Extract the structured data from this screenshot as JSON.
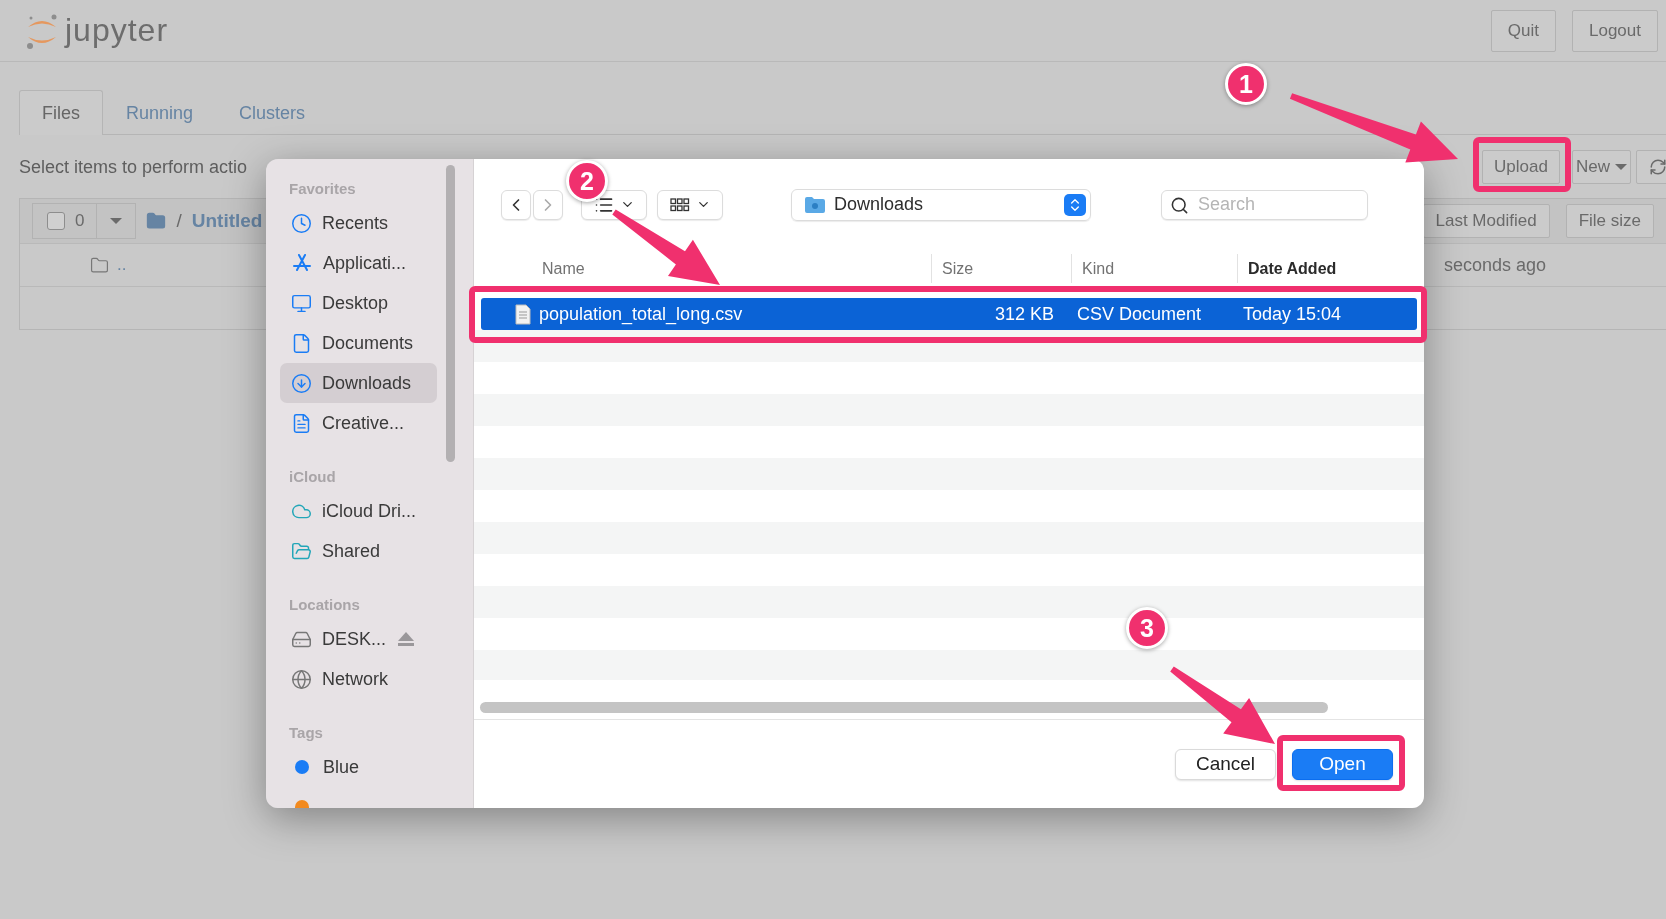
{
  "app": {
    "logo": "jupyter",
    "buttons": [
      "Quit",
      "Logout"
    ]
  },
  "tabs": [
    {
      "label": "Files",
      "selected": true
    },
    {
      "label": "Running",
      "selected": false
    },
    {
      "label": "Clusters",
      "selected": false
    }
  ],
  "toolbar": {
    "hint": "Select items to perform actio",
    "buttons": [
      {
        "kind": "text",
        "label": "Upload"
      },
      {
        "kind": "dropdown",
        "label": "New"
      },
      {
        "kind": "refresh"
      }
    ]
  },
  "file_list": {
    "checked": false,
    "count": "0",
    "root": "/",
    "path": "Untitled",
    "sort_buttons": [
      "Last Modified",
      "File size"
    ],
    "rows": [
      {
        "name": "..",
        "modified": "seconds ago"
      }
    ]
  },
  "dialog": {
    "location": "Downloads",
    "search_placeholder": "Search",
    "sidebar": [
      {
        "heading": "Favorites",
        "items": [
          {
            "kind": "place",
            "label": "Recents",
            "selected": false
          },
          {
            "kind": "place",
            "label": "Applicati...",
            "selected": false
          },
          {
            "kind": "place",
            "label": "Desktop",
            "selected": false
          },
          {
            "kind": "place",
            "label": "Documents",
            "selected": false
          },
          {
            "kind": "place",
            "label": "Downloads",
            "selected": true
          },
          {
            "kind": "place",
            "label": "Creative...",
            "selected": false
          }
        ]
      },
      {
        "heading": "iCloud",
        "items": [
          {
            "kind": "place",
            "label": "iCloud Dri...",
            "selected": false
          },
          {
            "kind": "place",
            "label": "Shared",
            "selected": false
          }
        ]
      },
      {
        "heading": "Locations",
        "items": [
          {
            "kind": "place",
            "label": "DESK...",
            "selected": false
          },
          {
            "kind": "place",
            "label": "Network",
            "selected": false
          }
        ]
      },
      {
        "heading": "Tags",
        "items": [
          {
            "kind": "tag",
            "label": "Blue",
            "color": "#1a7cf5",
            "selected": false
          },
          {
            "kind": "tag",
            "color": "#f28a1f",
            "selected": false
          }
        ]
      }
    ],
    "columns": [
      {
        "label": "Name",
        "sorted": false
      },
      {
        "label": "Size",
        "sorted": false
      },
      {
        "label": "Kind",
        "sorted": false
      },
      {
        "label": "Date Added",
        "sorted": true
      }
    ],
    "files": [
      {
        "name": "population_total_long.csv",
        "size": "312 KB",
        "kind": "CSV Document",
        "date_added": "Today 15:04",
        "selected": true
      }
    ],
    "buttons": [
      {
        "label": "Cancel",
        "primary": false
      },
      {
        "label": "Open",
        "primary": true
      }
    ]
  },
  "annotations": [
    {
      "number": "1"
    },
    {
      "number": "2"
    },
    {
      "number": "3"
    }
  ]
}
